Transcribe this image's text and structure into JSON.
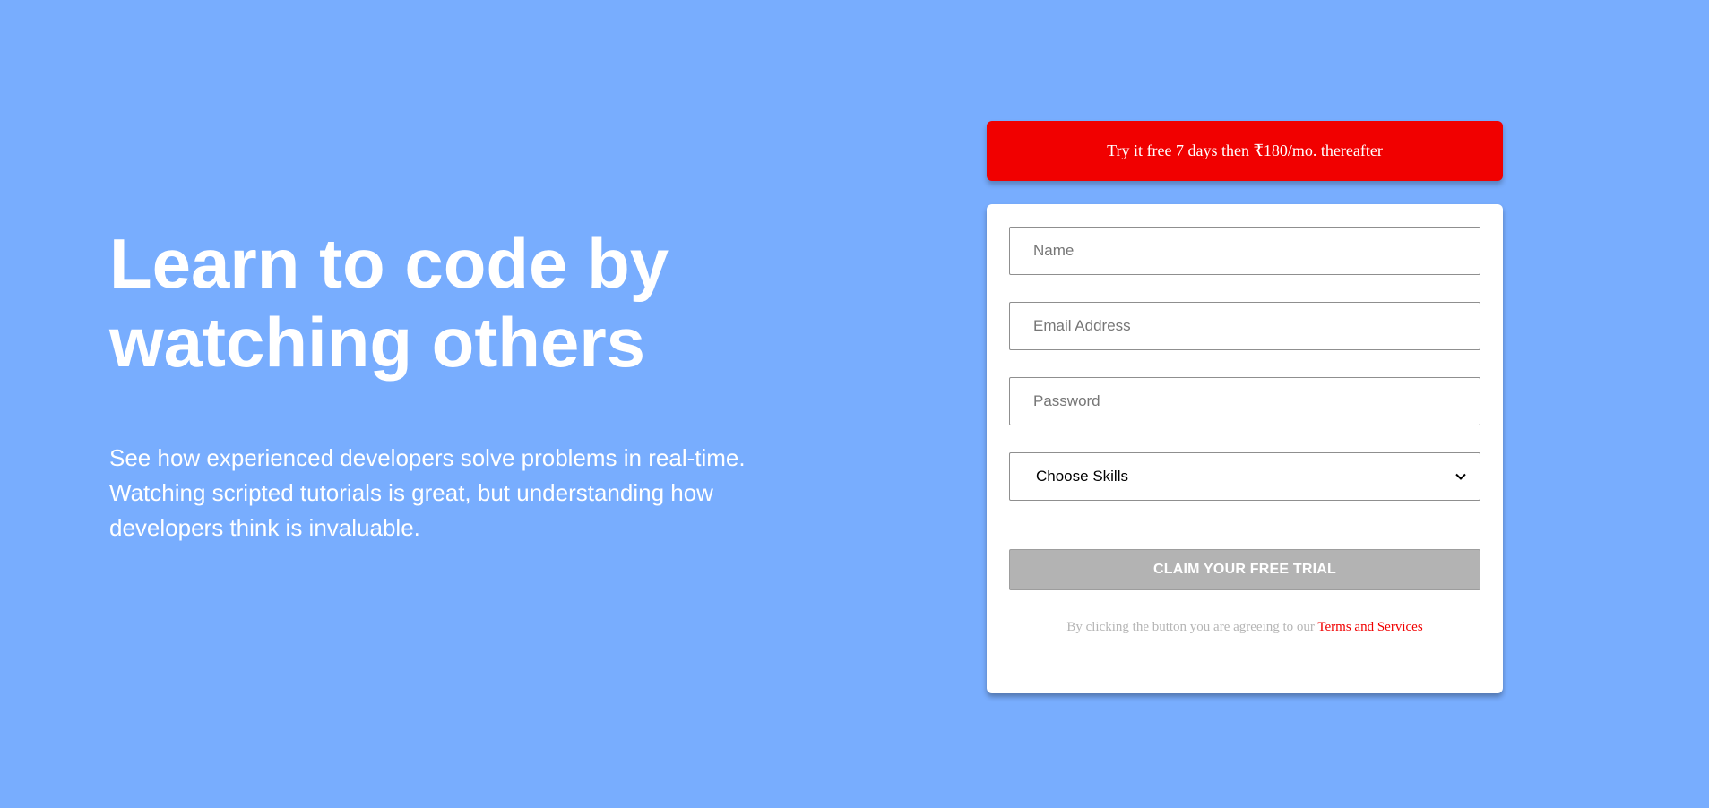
{
  "colors": {
    "background": "#78adfe",
    "accent": "#f10000",
    "button": "#b3b3b3",
    "card": "#ffffff"
  },
  "hero": {
    "title": "Learn to code by watching others",
    "subtitle": "See how experienced developers solve problems in real-time. Watching scripted tutorials is great, but understanding how developers think is invaluable."
  },
  "promo": {
    "text": "Try it free 7 days then ₹180/mo. thereafter"
  },
  "form": {
    "name_placeholder": "Name",
    "email_placeholder": "Email Address",
    "password_placeholder": "Password",
    "skills_select": {
      "selected": "Choose Skills",
      "icon": "chevron-down-icon"
    },
    "submit_label": "CLAIM YOUR FREE TRIAL",
    "legal_prefix": "By clicking the button you are agreeing to our",
    "legal_link": "Terms and Services"
  }
}
